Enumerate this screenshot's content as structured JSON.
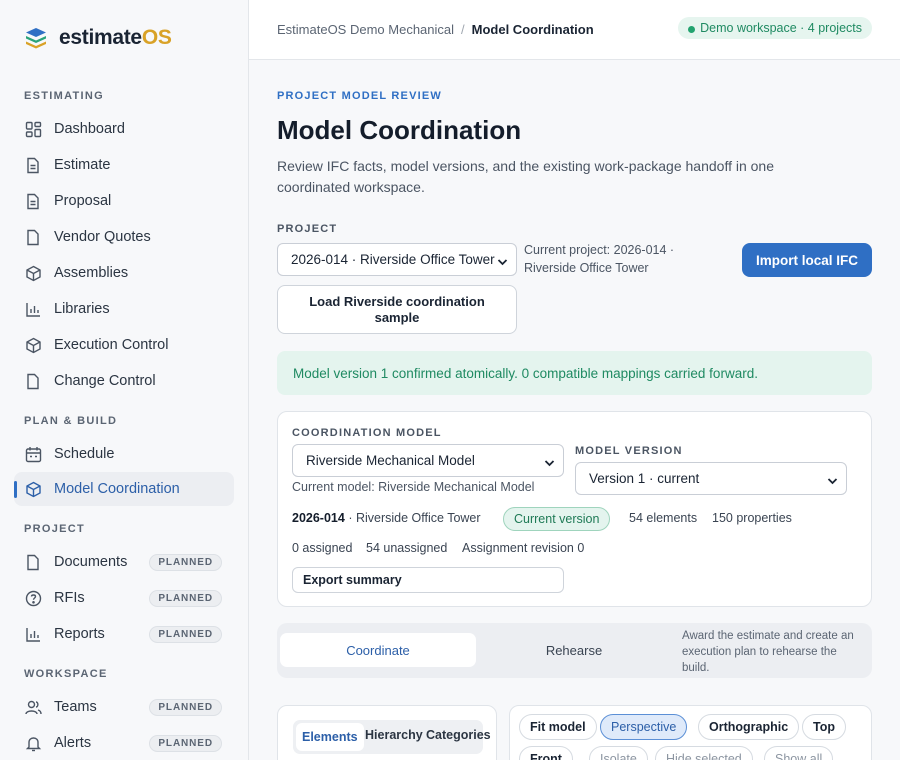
{
  "app": {
    "logo_main": "estimate",
    "logo_os": "OS"
  },
  "sidebar": {
    "sections": {
      "estimating": "ESTIMATING",
      "plan_build": "PLAN & BUILD",
      "project": "PROJECT",
      "workspace": "WORKSPACE"
    },
    "items": {
      "dashboard": "Dashboard",
      "estimate": "Estimate",
      "proposal": "Proposal",
      "vendor_quotes": "Vendor Quotes",
      "assemblies": "Assemblies",
      "libraries": "Libraries",
      "execution_control": "Execution Control",
      "change_control": "Change Control",
      "schedule": "Schedule",
      "model_coordination": "Model Coordination",
      "documents": "Documents",
      "rfis": "RFIs",
      "reports": "Reports",
      "teams": "Teams",
      "alerts": "Alerts"
    },
    "planned_label": "PLANNED"
  },
  "topbar": {
    "breadcrumb_parent": "EstimateOS Demo Mechanical",
    "breadcrumb_sep": "/",
    "breadcrumb_current": "Model Coordination",
    "workspace_pill": "Demo workspace · 4 projects"
  },
  "page": {
    "eyebrow": "PROJECT MODEL REVIEW",
    "title": "Model Coordination",
    "description": "Review IFC facts, model versions, and the existing work-package handoff in one coordinated workspace.",
    "project_label": "PROJECT",
    "project_select": "2026-014 · Riverside Office Tower",
    "current_project": "Current project: 2026-014 · Riverside Office Tower",
    "import_button": "Import local IFC",
    "sample_button": "Load Riverside coordination sample",
    "notice": "Model version 1 confirmed atomically. 0 compatible mappings carried forward."
  },
  "coordination": {
    "model_label": "COORDINATION MODEL",
    "model_select": "Riverside Mechanical Model",
    "current_model": "Current model: Riverside Mechanical Model",
    "version_label": "MODEL VERSION",
    "version_select": "Version 1 · current",
    "project_code": "2026-014",
    "project_name": "· Riverside Office Tower",
    "current_version_pill": "Current version",
    "elements": "54 elements",
    "properties": "150 properties",
    "assigned": "0 assigned",
    "unassigned": "54 unassigned",
    "revision": "Assignment revision 0",
    "export_button": "Export summary"
  },
  "tabs": {
    "coordinate": "Coordinate",
    "rehearse": "Rehearse",
    "hint": "Award the estimate and create an execution plan to rehearse the build."
  },
  "browser": {
    "elements": "Elements",
    "hierarchy": "Hierarchy",
    "categories": "Categories"
  },
  "viewer": {
    "fit_model": "Fit model",
    "perspective": "Perspective",
    "orthographic": "Orthographic",
    "top": "Top",
    "front": "Front",
    "isolate": "Isolate",
    "hide_selected": "Hide selected",
    "show_all": "Show all"
  },
  "colors": {
    "accent": "#2f6fc4",
    "success": "#1f8a62",
    "logo_gold": "#d9a227"
  }
}
